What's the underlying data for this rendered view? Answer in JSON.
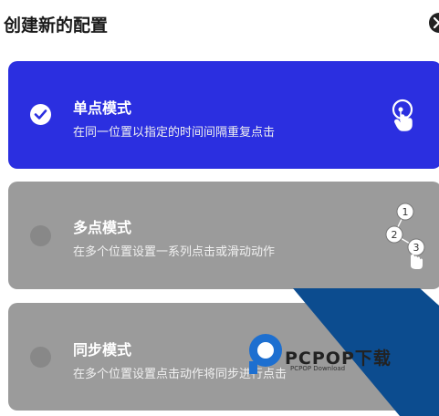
{
  "header": {
    "title": "创建新的配置"
  },
  "modes": [
    {
      "title": "单点模式",
      "description": "在同一位置以指定的时间间隔重复点击",
      "selected": true,
      "icon": "single-tap-icon"
    },
    {
      "title": "多点模式",
      "description": "在多个位置设置一系列点击或滑动动作",
      "selected": false,
      "icon": "multi-tap-icon",
      "steps": [
        "1",
        "2",
        "3"
      ]
    },
    {
      "title": "同步模式",
      "description": "在多个位置设置点击动作将同步进行点击",
      "selected": false,
      "icon": "sync-tap-icon"
    }
  ],
  "watermark": {
    "text": "PCPOP下载",
    "subtext": "PCPOP Download"
  },
  "colors": {
    "selected_card": "#2b2fe0",
    "unselected_card": "#9b9b9b",
    "watermark_blue": "#0c4c8f"
  }
}
